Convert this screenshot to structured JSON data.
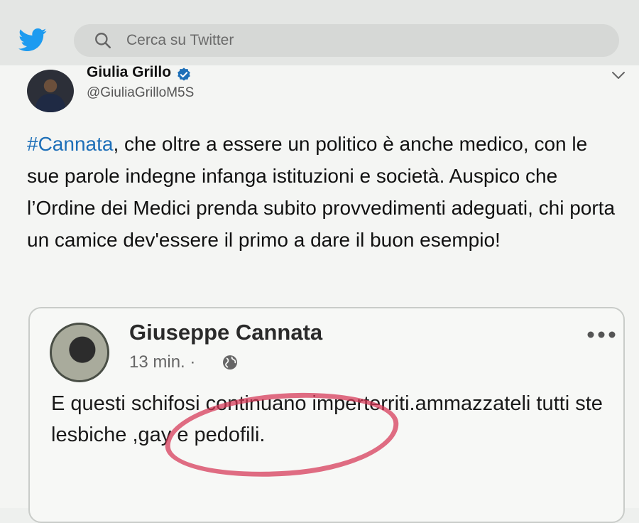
{
  "colors": {
    "twitter_blue": "#1d9bf0",
    "hashtag_blue": "#1d6fb8",
    "annotation_red": "#d63654"
  },
  "header": {
    "logo_icon": "twitter-bird-icon",
    "search_placeholder": "Cerca su Twitter"
  },
  "tweet": {
    "author_name": "Giulia Grillo",
    "author_handle": "@GiuliaGrilloM5S",
    "hashtag": "#Cannata",
    "text_rest": ", che oltre a essere un politico è anche medico, con le sue parole indegne infanga istituzioni e società. Auspico che l’Ordine dei Medici prenda subito provvedimenti adeguati, chi porta un camice dev'essere il primo a dare il buon esempio!"
  },
  "quoted_post": {
    "author_name": "Giuseppe Cannata",
    "timestamp": "13 min. ·",
    "text": "E questi schifosi continuano imperterriti.ammazzateli tutti ste lesbiche ,gay e pedofili."
  }
}
